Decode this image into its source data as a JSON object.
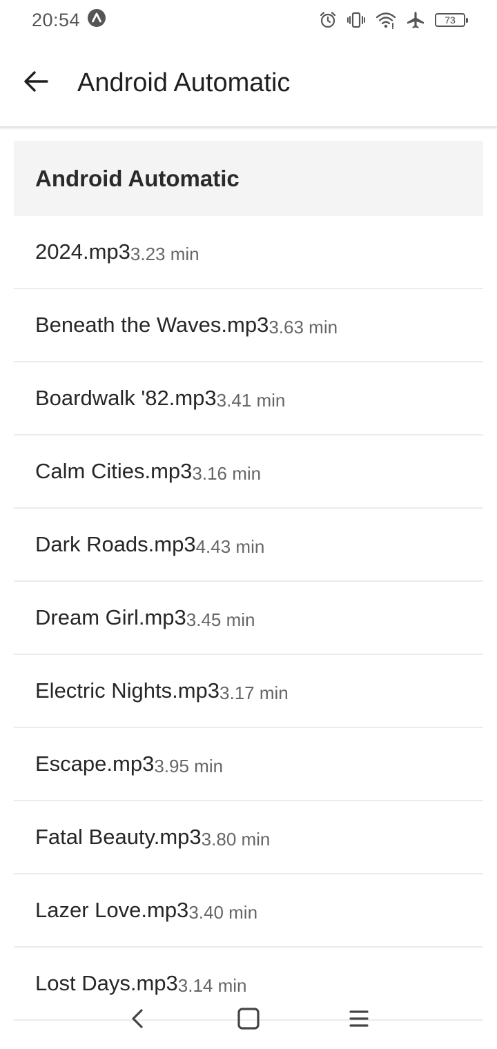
{
  "status_bar": {
    "time": "20:54",
    "battery_level": "73",
    "icons": [
      "app-notification-icon",
      "alarm-icon",
      "vibrate-icon",
      "wifi-icon",
      "airplane-icon",
      "battery-icon"
    ]
  },
  "app_bar": {
    "title": "Android Automatic",
    "back_icon": "arrow-back-icon"
  },
  "section": {
    "header": "Android Automatic"
  },
  "tracks": [
    {
      "name": "2024.mp3",
      "duration": "3.23 min"
    },
    {
      "name": "Beneath the Waves.mp3",
      "duration": "3.63 min"
    },
    {
      "name": "Boardwalk '82.mp3",
      "duration": "3.41 min"
    },
    {
      "name": "Calm Cities.mp3",
      "duration": "3.16 min"
    },
    {
      "name": "Dark Roads.mp3",
      "duration": "4.43 min"
    },
    {
      "name": "Dream Girl.mp3",
      "duration": "3.45 min"
    },
    {
      "name": "Electric Nights.mp3",
      "duration": "3.17 min"
    },
    {
      "name": "Escape.mp3",
      "duration": "3.95 min"
    },
    {
      "name": "Fatal Beauty.mp3",
      "duration": "3.80 min"
    },
    {
      "name": "Lazer Love.mp3",
      "duration": "3.40 min"
    },
    {
      "name": "Lost Days.mp3",
      "duration": "3.14 min"
    }
  ],
  "nav_bar": {
    "icons": [
      "nav-back-icon",
      "nav-home-icon",
      "nav-menu-icon"
    ]
  },
  "colors": {
    "background": "#ffffff",
    "section_header_bg": "#f4f4f4",
    "divider": "#ebebeb",
    "primary_text": "#262626",
    "secondary_text": "#666666"
  }
}
